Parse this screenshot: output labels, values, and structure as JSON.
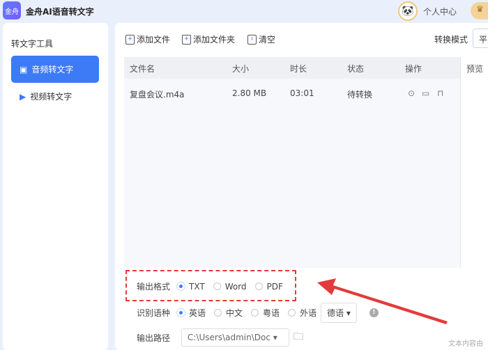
{
  "app": {
    "title": "金舟AI语音转文字",
    "logo_text": "金舟",
    "user_center": "个人中心",
    "vip_icon": "crown-icon"
  },
  "sidebar": {
    "heading": "转文字工具",
    "items": [
      {
        "label": "音频转文字",
        "active": true
      },
      {
        "label": "视频转文字",
        "active": false
      }
    ]
  },
  "toolbar": {
    "add_file": "添加文件",
    "add_folder": "添加文件夹",
    "clear": "清空",
    "mode_label": "转换模式",
    "mode_value": "平"
  },
  "table": {
    "headers": [
      "文件名",
      "大小",
      "时长",
      "状态",
      "操作"
    ],
    "preview_header": "预览",
    "rows": [
      {
        "name": "复盘会议.m4a",
        "size": "2.80 MB",
        "duration": "03:01",
        "status": "待转换",
        "actions": [
          "play-icon",
          "folder-icon",
          "trash-icon"
        ]
      }
    ]
  },
  "output_format": {
    "label": "输出格式",
    "options": [
      "TXT",
      "Word",
      "PDF"
    ],
    "selected": "TXT"
  },
  "language": {
    "label": "识别语种",
    "options": [
      "英语",
      "中文",
      "粤语",
      "外语"
    ],
    "selected": "英语",
    "foreign_value": "德语"
  },
  "output_path": {
    "label": "输出路径",
    "value": "C:\\Users\\admin\\Doc"
  },
  "watermark": "文本内容由",
  "colors": {
    "accent": "#3d7af5",
    "annotation": "#e33b3b"
  }
}
